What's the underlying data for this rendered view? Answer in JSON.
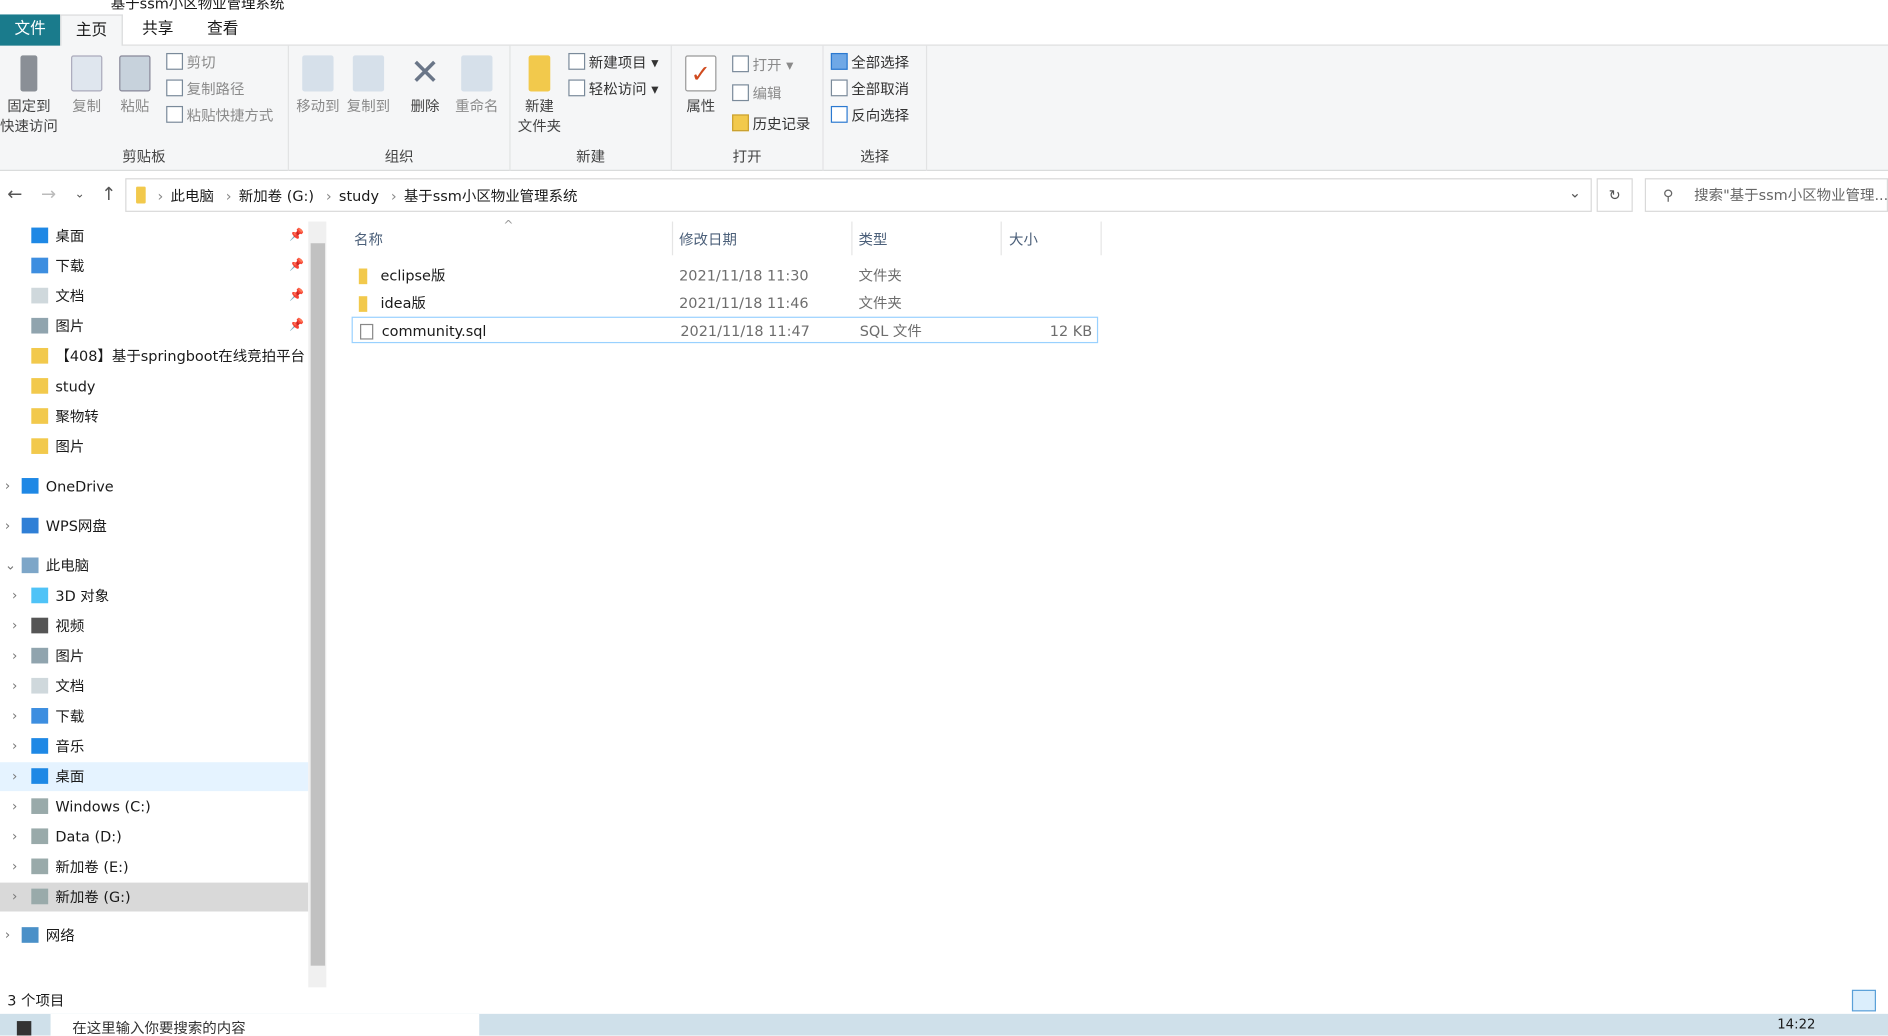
{
  "window": {
    "title": "基于ssm小区物业管理系统"
  },
  "ribbon_tabs": [
    "文件",
    "主页",
    "共享",
    "查看"
  ],
  "ribbon": {
    "clipboard": {
      "label": "剪贴板",
      "pin": "固定到\n快速访问",
      "copy": "复制",
      "paste": "粘贴",
      "cut": "剪切",
      "copy_path": "复制路径",
      "paste_shortcut": "粘贴快捷方式"
    },
    "organize": {
      "label": "组织",
      "move_to": "移动到",
      "copy_to": "复制到",
      "delete": "删除",
      "rename": "重命名"
    },
    "new": {
      "label": "新建",
      "new_folder": "新建\n文件夹",
      "new_item": "新建项目",
      "easy_access": "轻松访问"
    },
    "open": {
      "label": "打开",
      "properties": "属性",
      "open": "打开",
      "edit": "编辑",
      "history": "历史记录"
    },
    "select": {
      "label": "选择",
      "select_all": "全部选择",
      "select_none": "全部取消",
      "invert": "反向选择"
    }
  },
  "address": {
    "crumbs": [
      "此电脑",
      "新加卷 (G:)",
      "study",
      "基于ssm小区物业管理系统"
    ],
    "search_placeholder": "搜索\"基于ssm小区物业管理..."
  },
  "nav": {
    "quick": [
      {
        "label": "桌面",
        "pinned": true
      },
      {
        "label": "下载",
        "pinned": true
      },
      {
        "label": "文档",
        "pinned": true
      },
      {
        "label": "图片",
        "pinned": true
      },
      {
        "label": "【408】基于springboot在线竞拍平台"
      },
      {
        "label": "study"
      },
      {
        "label": "聚物转"
      },
      {
        "label": "图片"
      }
    ],
    "onedrive": "OneDrive",
    "wps": "WPS网盘",
    "this_pc": "此电脑",
    "pc": [
      "3D 对象",
      "视频",
      "图片",
      "文档",
      "下载",
      "音乐",
      "桌面",
      "Windows (C:)",
      "Data (D:)",
      "新加卷 (E:)",
      "新加卷 (G:)"
    ],
    "network": "网络"
  },
  "columns": {
    "name": "名称",
    "date": "修改日期",
    "type": "类型",
    "size": "大小"
  },
  "files": [
    {
      "name": "eclipse版",
      "date": "2021/11/18 11:30",
      "type": "文件夹",
      "size": ""
    },
    {
      "name": "idea版",
      "date": "2021/11/18 11:46",
      "type": "文件夹",
      "size": ""
    },
    {
      "name": "community.sql",
      "date": "2021/11/18 11:47",
      "type": "SQL 文件",
      "size": "12 KB"
    }
  ],
  "status": "3 个项目",
  "taskbar": {
    "search": "在这里输入你要搜索的内容",
    "time": "14:22"
  }
}
